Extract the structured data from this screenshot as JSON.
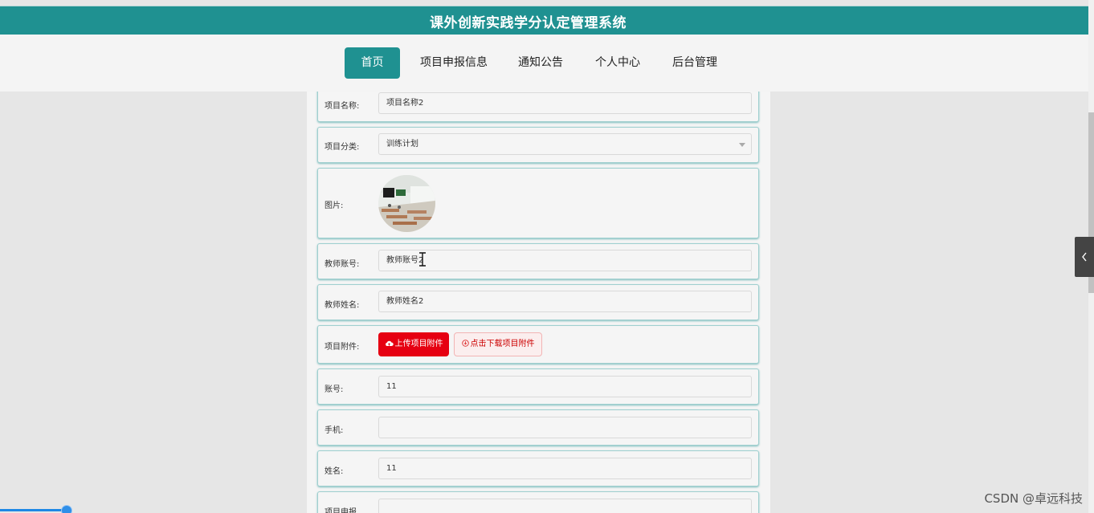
{
  "header": {
    "title": "课外创新实践学分认定管理系统"
  },
  "nav": {
    "items": [
      "首页",
      "项目申报信息",
      "通知公告",
      "个人中心",
      "后台管理"
    ],
    "active_index": 0
  },
  "form": {
    "project_name": {
      "label": "项目名称:",
      "value": "项目名称2"
    },
    "project_category": {
      "label": "项目分类:",
      "value": "训练计划"
    },
    "image": {
      "label": "图片:"
    },
    "teacher_account": {
      "label": "教师账号:",
      "value": "教师账号2"
    },
    "teacher_name": {
      "label": "教师姓名:",
      "value": "教师姓名2"
    },
    "attachment": {
      "label": "项目附件:",
      "upload_label": "上传项目附件",
      "download_label": "点击下载项目附件"
    },
    "account": {
      "label": "账号:",
      "value": "11"
    },
    "phone": {
      "label": "手机:",
      "value": ""
    },
    "name": {
      "label": "姓名:",
      "value": "11"
    },
    "project_report": {
      "label": "项目申报"
    }
  },
  "watermark": "CSDN @卓远科技",
  "colors": {
    "primary": "#1f9191",
    "danger": "#e60012"
  }
}
